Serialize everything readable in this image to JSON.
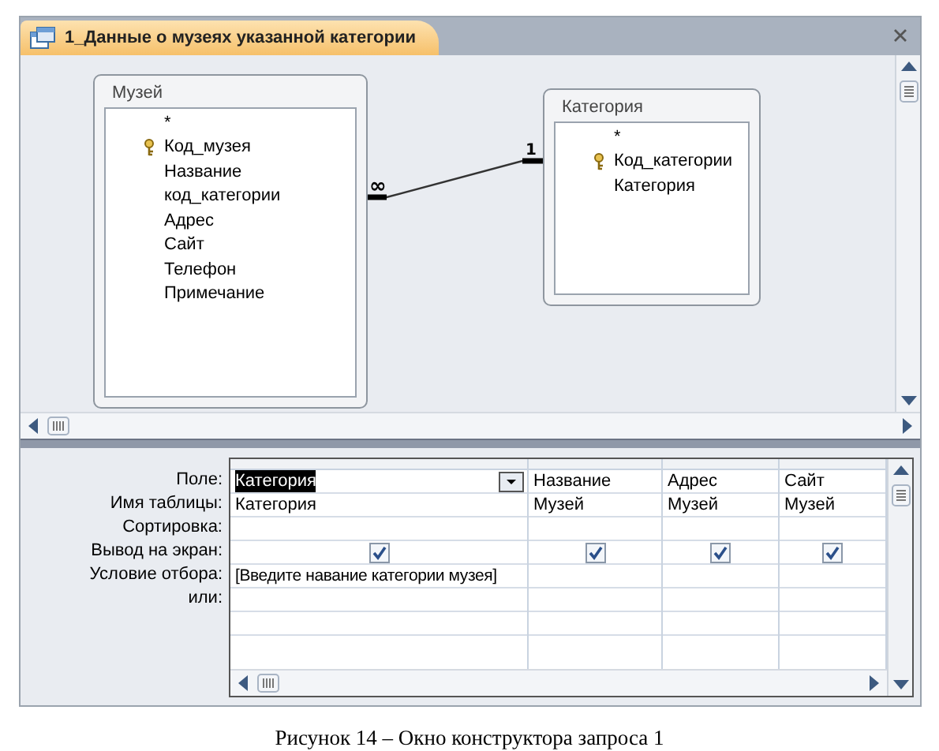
{
  "tab": {
    "title": "1_Данные о музеях указанной категории",
    "selected": true
  },
  "tables": [
    {
      "name": "Музей",
      "fields": [
        {
          "name": "*",
          "key": false
        },
        {
          "name": "Код_музея",
          "key": true
        },
        {
          "name": "Название",
          "key": false
        },
        {
          "name": "код_категории",
          "key": false
        },
        {
          "name": "Адрес",
          "key": false
        },
        {
          "name": "Сайт",
          "key": false
        },
        {
          "name": "Телефон",
          "key": false
        },
        {
          "name": "Примечание",
          "key": false
        }
      ]
    },
    {
      "name": "Категория",
      "fields": [
        {
          "name": "*",
          "key": false
        },
        {
          "name": "Код_категории",
          "key": true
        },
        {
          "name": "Категория",
          "key": false
        }
      ]
    }
  ],
  "relationship": {
    "one_label": "1",
    "many_label": "∞"
  },
  "grid": {
    "row_labels": [
      "Поле:",
      "Имя таблицы:",
      "Сортировка:",
      "Вывод на экран:",
      "Условие отбора:",
      "или:"
    ],
    "columns": [
      {
        "field": "Категория",
        "selected": true,
        "table": "Категория",
        "show": true,
        "criteria": "[Введите навание категории музея]"
      },
      {
        "field": "Название",
        "selected": false,
        "table": "Музей",
        "show": true
      },
      {
        "field": "Адрес",
        "selected": false,
        "table": "Музей",
        "show": true
      },
      {
        "field": "Сайт",
        "selected": false,
        "table": "Музей",
        "show": true
      }
    ]
  },
  "caption": "Рисунок 14 – Окно конструктора запроса 1"
}
